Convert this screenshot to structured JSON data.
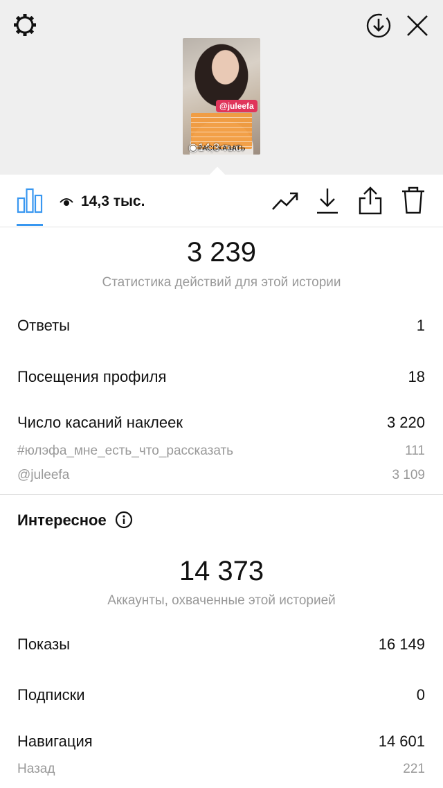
{
  "story_thumbnail": {
    "mention_tag": "@juleefa",
    "views_overlay": "14,3 тыс.",
    "cta_text": "РАССКАЗАТЬ"
  },
  "toolbar": {
    "views_count": "14,3 тыс."
  },
  "interactions": {
    "total": "3 239",
    "subtitle": "Статистика действий для этой истории",
    "rows": [
      {
        "label": "Ответы",
        "value": "1"
      },
      {
        "label": "Посещения профиля",
        "value": "18"
      },
      {
        "label": "Число касаний наклеек",
        "value": "3 220"
      }
    ],
    "sticker_rows": [
      {
        "label": "#юлэфа_мне_есть_что_рассказать",
        "value": "111"
      },
      {
        "label": "@juleefa",
        "value": "3 109"
      }
    ]
  },
  "discovery": {
    "title": "Интересное",
    "total": "14 373",
    "subtitle": "Аккаунты, охваченные этой историей",
    "rows": [
      {
        "label": "Показы",
        "value": "16 149"
      },
      {
        "label": "Подписки",
        "value": "0"
      },
      {
        "label": "Навигация",
        "value": "14 601"
      }
    ],
    "nav_rows": [
      {
        "label": "Назад",
        "value": "221"
      }
    ]
  },
  "colors": {
    "accent": "#3897f0",
    "header_bg": "#efefef",
    "muted_text": "#999999"
  },
  "icons": [
    "settings-gear-icon",
    "download-circle-icon",
    "close-icon",
    "bar-chart-icon",
    "eye-icon",
    "trending-icon",
    "download-icon",
    "share-icon",
    "trash-icon",
    "info-icon"
  ]
}
